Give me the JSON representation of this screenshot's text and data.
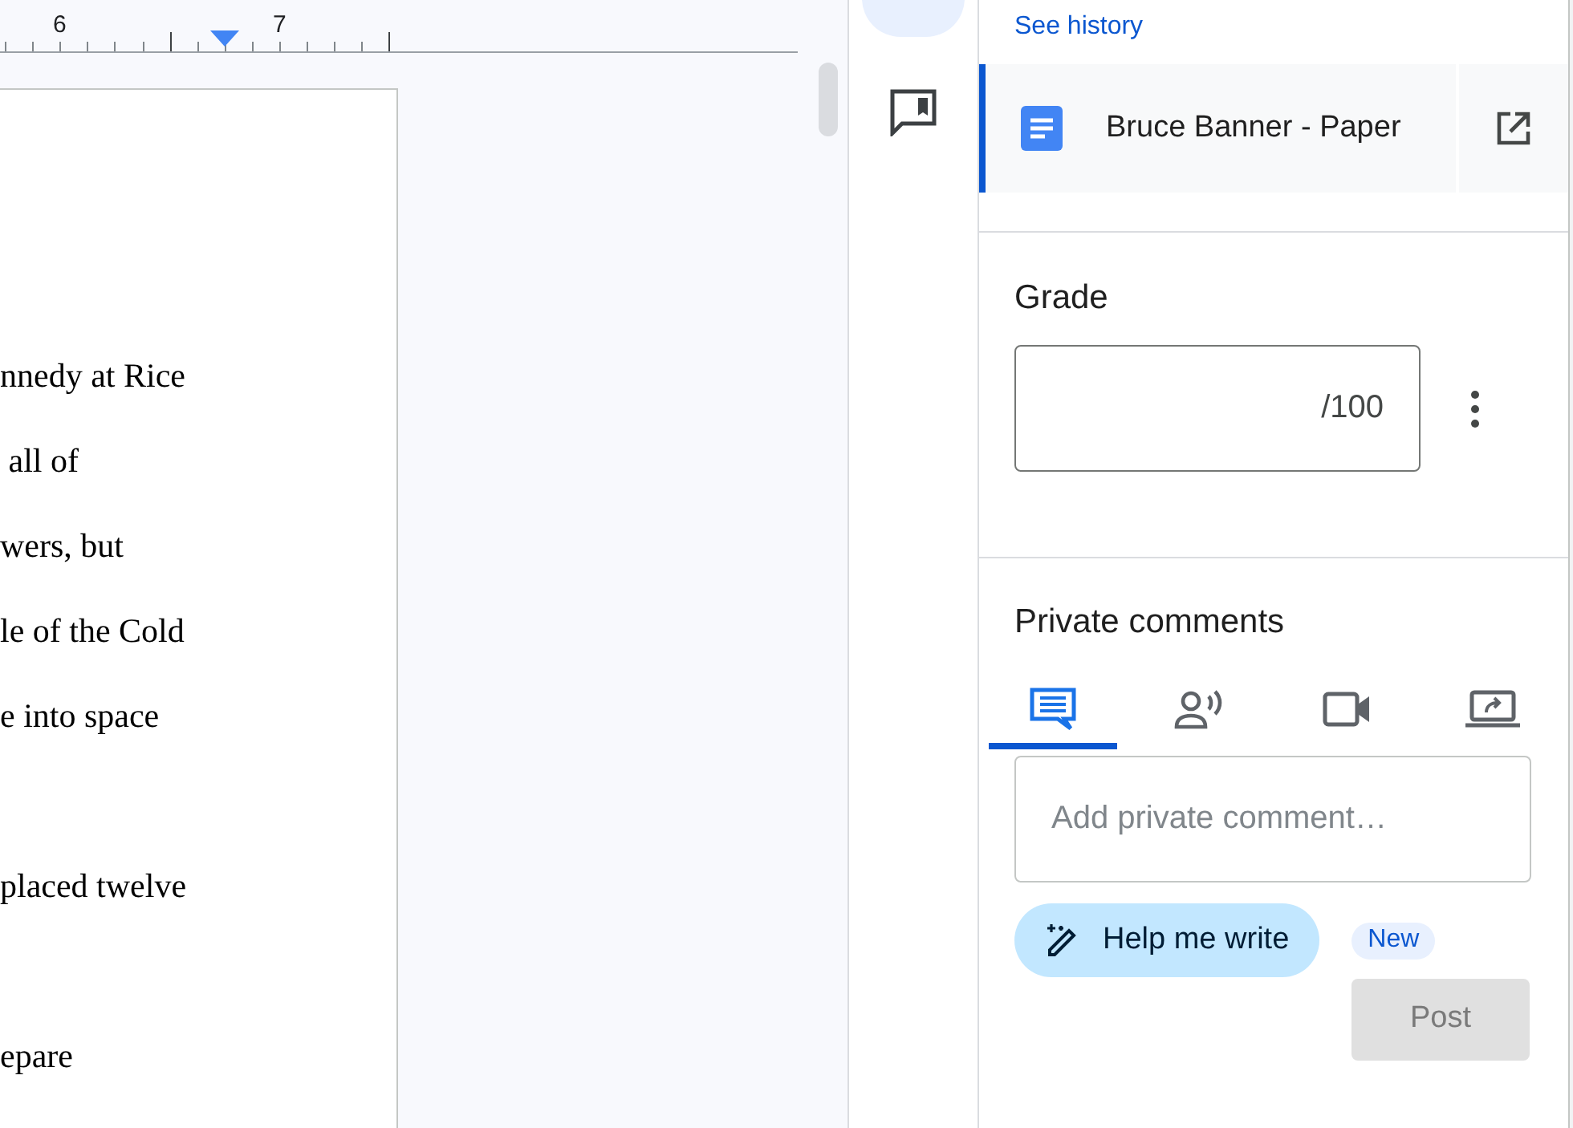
{
  "ruler": {
    "labels": [
      "6",
      "7"
    ]
  },
  "document": {
    "paragraphs": [
      {
        "lines": [
          "nnedy at Rice",
          " all of",
          "wers, but",
          "le of the Cold",
          "e into space"
        ]
      },
      {
        "lines": [
          "placed twelve"
        ]
      },
      {
        "lines": [
          "epare"
        ]
      }
    ]
  },
  "panel": {
    "history_link": "See history",
    "attachment": {
      "title": "Bruce Banner - Paper",
      "selected": true
    },
    "grade": {
      "heading": "Grade",
      "placeholder": "/100"
    },
    "private_comments": {
      "heading": "Private comments",
      "tabs": [
        {
          "kind": "text",
          "selected": true
        },
        {
          "kind": "voice",
          "selected": false
        },
        {
          "kind": "video",
          "selected": false
        },
        {
          "kind": "screen",
          "selected": false
        }
      ],
      "placeholder": "Add private comment…",
      "help_button": "Help me write",
      "badge": "New",
      "post_button": "Post",
      "post_disabled": true
    }
  }
}
